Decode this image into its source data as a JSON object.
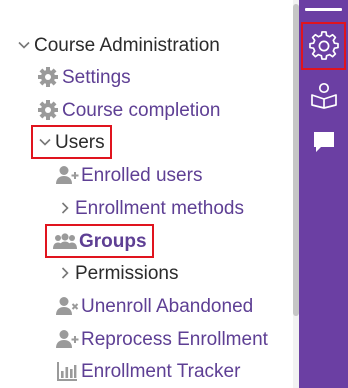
{
  "tree": {
    "course_administration": "Course Administration",
    "settings": "Settings",
    "course_completion": "Course completion",
    "users": "Users",
    "enrolled_users": "Enrolled users",
    "enrollment_methods": "Enrollment methods",
    "groups": "Groups",
    "permissions": "Permissions",
    "unenroll_abandoned": "Unenroll Abandoned",
    "reprocess_enrollment": "Reprocess Enrollment",
    "enrollment_tracker": "Enrollment Tracker"
  },
  "rail": {
    "items": [
      "gear-icon",
      "course-reader-icon",
      "chat-icon"
    ]
  },
  "colors": {
    "link": "#5e3f94",
    "text": "#2b2b2b",
    "icon_gray": "#9a9a9a",
    "rail": "#6b3fa3",
    "highlight": "#e0141e"
  }
}
